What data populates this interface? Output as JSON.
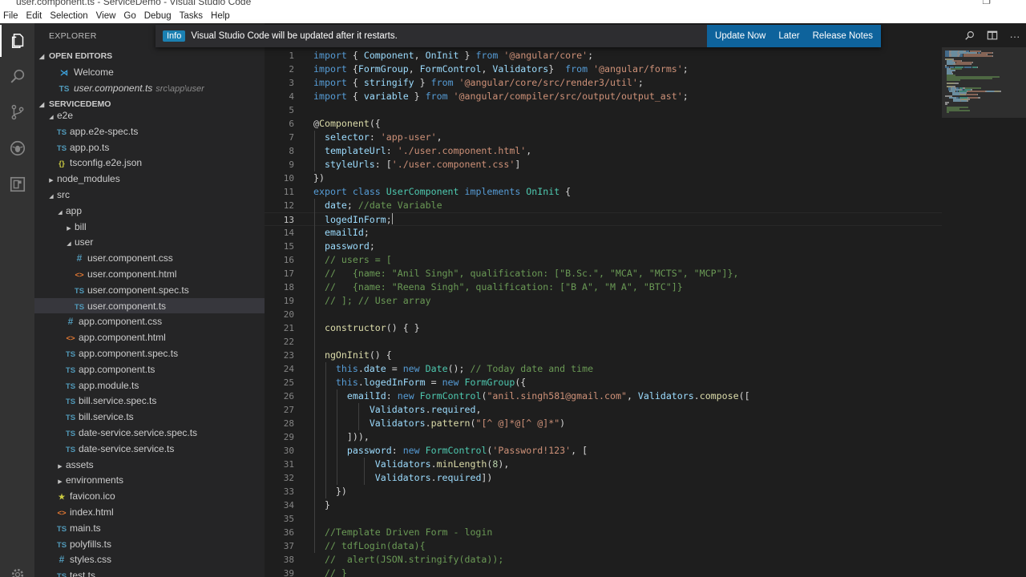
{
  "window": {
    "title": "user.component.ts - ServiceDemo - Visual Studio Code"
  },
  "menu": [
    "File",
    "Edit",
    "Selection",
    "View",
    "Go",
    "Debug",
    "Tasks",
    "Help"
  ],
  "activity_bar": [
    "files-icon",
    "search-icon",
    "source-control-icon",
    "debug-icon",
    "extensions-icon",
    "gear-icon"
  ],
  "sidebar": {
    "title": "EXPLORER",
    "open_editors": {
      "header": "OPEN EDITORS",
      "items": [
        {
          "icon": "vscode-icon",
          "name": "Welcome",
          "desc": ""
        },
        {
          "icon": "TS",
          "name": "user.component.ts",
          "desc": "src\\app\\user"
        }
      ]
    },
    "project": {
      "header": "SERVICEDEMO",
      "tree": [
        {
          "label": "e2e",
          "type": "folder",
          "open": true,
          "depth": 0
        },
        {
          "label": "app.e2e-spec.ts",
          "type": "ts",
          "depth": 1
        },
        {
          "label": "app.po.ts",
          "type": "ts",
          "depth": 1
        },
        {
          "label": "tsconfig.e2e.json",
          "type": "json",
          "depth": 1
        },
        {
          "label": "node_modules",
          "type": "folder",
          "open": false,
          "depth": 0
        },
        {
          "label": "src",
          "type": "folder",
          "open": true,
          "depth": 0
        },
        {
          "label": "app",
          "type": "folder",
          "open": true,
          "depth": 1
        },
        {
          "label": "bill",
          "type": "folder",
          "open": false,
          "depth": 2
        },
        {
          "label": "user",
          "type": "folder",
          "open": true,
          "depth": 2
        },
        {
          "label": "user.component.css",
          "type": "css",
          "depth": 3
        },
        {
          "label": "user.component.html",
          "type": "html",
          "depth": 3
        },
        {
          "label": "user.component.spec.ts",
          "type": "ts",
          "depth": 3
        },
        {
          "label": "user.component.ts",
          "type": "ts",
          "depth": 3,
          "selected": true
        },
        {
          "label": "app.component.css",
          "type": "css",
          "depth": 2
        },
        {
          "label": "app.component.html",
          "type": "html",
          "depth": 2
        },
        {
          "label": "app.component.spec.ts",
          "type": "ts",
          "depth": 2
        },
        {
          "label": "app.component.ts",
          "type": "ts",
          "depth": 2
        },
        {
          "label": "app.module.ts",
          "type": "ts",
          "depth": 2
        },
        {
          "label": "bill.service.spec.ts",
          "type": "ts",
          "depth": 2
        },
        {
          "label": "bill.service.ts",
          "type": "ts",
          "depth": 2
        },
        {
          "label": "date-service.service.spec.ts",
          "type": "ts",
          "depth": 2
        },
        {
          "label": "date-service.service.ts",
          "type": "ts",
          "depth": 2
        },
        {
          "label": "assets",
          "type": "folder",
          "open": false,
          "depth": 1
        },
        {
          "label": "environments",
          "type": "folder",
          "open": false,
          "depth": 1
        },
        {
          "label": "favicon.ico",
          "type": "star",
          "depth": 1
        },
        {
          "label": "index.html",
          "type": "html",
          "depth": 1
        },
        {
          "label": "main.ts",
          "type": "ts",
          "depth": 1
        },
        {
          "label": "polyfills.ts",
          "type": "ts",
          "depth": 1
        },
        {
          "label": "styles.css",
          "type": "css",
          "depth": 1
        },
        {
          "label": "test.ts",
          "type": "ts",
          "depth": 1
        }
      ]
    }
  },
  "notification": {
    "badge": "Info",
    "message": "Visual Studio Code will be updated after it restarts.",
    "actions": [
      "Update Now",
      "Later",
      "Release Notes"
    ]
  },
  "editor_actions": [
    "open-preview-icon",
    "split-editor-icon",
    "more-icon"
  ],
  "editor": {
    "cursor_line": 13,
    "lines": [
      [
        [
          "k",
          "import"
        ],
        [
          "p",
          " { "
        ],
        [
          "v",
          "Component"
        ],
        [
          "p",
          ", "
        ],
        [
          "v",
          "OnInit"
        ],
        [
          "p",
          " } "
        ],
        [
          "k",
          "from"
        ],
        [
          "p",
          " "
        ],
        [
          "s",
          "'@angular/core'"
        ],
        [
          "p",
          ";"
        ]
      ],
      [
        [
          "k",
          "import"
        ],
        [
          "p",
          " {"
        ],
        [
          "v",
          "FormGroup"
        ],
        [
          "p",
          ", "
        ],
        [
          "v",
          "FormControl"
        ],
        [
          "p",
          ", "
        ],
        [
          "v",
          "Validators"
        ],
        [
          "p",
          "}  "
        ],
        [
          "k",
          "from"
        ],
        [
          "p",
          " "
        ],
        [
          "s",
          "'@angular/forms'"
        ],
        [
          "p",
          ";"
        ]
      ],
      [
        [
          "k",
          "import"
        ],
        [
          "p",
          " { "
        ],
        [
          "v",
          "stringify"
        ],
        [
          "p",
          " } "
        ],
        [
          "k",
          "from"
        ],
        [
          "p",
          " "
        ],
        [
          "s",
          "'@angular/core/src/render3/util'"
        ],
        [
          "p",
          ";"
        ]
      ],
      [
        [
          "k",
          "import"
        ],
        [
          "p",
          " { "
        ],
        [
          "v",
          "variable"
        ],
        [
          "p",
          " } "
        ],
        [
          "k",
          "from"
        ],
        [
          "p",
          " "
        ],
        [
          "s",
          "'@angular/compiler/src/output/output_ast'"
        ],
        [
          "p",
          ";"
        ]
      ],
      [],
      [
        [
          "p",
          "@"
        ],
        [
          "f",
          "Component"
        ],
        [
          "p",
          "({"
        ]
      ],
      [
        [
          "p",
          "  "
        ],
        [
          "v",
          "selector"
        ],
        [
          "p",
          ": "
        ],
        [
          "s",
          "'app-user'"
        ],
        [
          "p",
          ","
        ]
      ],
      [
        [
          "p",
          "  "
        ],
        [
          "v",
          "templateUrl"
        ],
        [
          "p",
          ": "
        ],
        [
          "s",
          "'./user.component.html'"
        ],
        [
          "p",
          ","
        ]
      ],
      [
        [
          "p",
          "  "
        ],
        [
          "v",
          "styleUrls"
        ],
        [
          "p",
          ": ["
        ],
        [
          "s",
          "'./user.component.css'"
        ],
        [
          "p",
          "]"
        ]
      ],
      [
        [
          "p",
          "})"
        ]
      ],
      [
        [
          "k",
          "export"
        ],
        [
          "p",
          " "
        ],
        [
          "k",
          "class"
        ],
        [
          "p",
          " "
        ],
        [
          "t",
          "UserComponent"
        ],
        [
          "p",
          " "
        ],
        [
          "k",
          "implements"
        ],
        [
          "p",
          " "
        ],
        [
          "t",
          "OnInit"
        ],
        [
          "p",
          " {"
        ]
      ],
      [
        [
          "p",
          "  "
        ],
        [
          "v",
          "date"
        ],
        [
          "p",
          "; "
        ],
        [
          "c",
          "//date Variable"
        ]
      ],
      [
        [
          "p",
          "  "
        ],
        [
          "v",
          "logedInForm"
        ],
        [
          "p",
          ";"
        ]
      ],
      [
        [
          "p",
          "  "
        ],
        [
          "v",
          "emailId"
        ],
        [
          "p",
          ";"
        ]
      ],
      [
        [
          "p",
          "  "
        ],
        [
          "v",
          "password"
        ],
        [
          "p",
          ";"
        ]
      ],
      [
        [
          "p",
          "  "
        ],
        [
          "c",
          "// users = ["
        ]
      ],
      [
        [
          "p",
          "  "
        ],
        [
          "c",
          "//   {name: \"Anil Singh\", qualification: [\"B.Sc.\", \"MCA\", \"MCTS\", \"MCP\"]},"
        ]
      ],
      [
        [
          "p",
          "  "
        ],
        [
          "c",
          "//   {name: \"Reena Singh\", qualification: [\"B A\", \"M A\", \"BTC\"]}"
        ]
      ],
      [
        [
          "p",
          "  "
        ],
        [
          "c",
          "// ]; // User array"
        ]
      ],
      [],
      [
        [
          "p",
          "  "
        ],
        [
          "f",
          "constructor"
        ],
        [
          "p",
          "() { }"
        ]
      ],
      [],
      [
        [
          "p",
          "  "
        ],
        [
          "f",
          "ngOnInit"
        ],
        [
          "p",
          "() {"
        ]
      ],
      [
        [
          "p",
          "    "
        ],
        [
          "k",
          "this"
        ],
        [
          "p",
          "."
        ],
        [
          "v",
          "date"
        ],
        [
          "p",
          " = "
        ],
        [
          "k",
          "new"
        ],
        [
          "p",
          " "
        ],
        [
          "t",
          "Date"
        ],
        [
          "p",
          "(); "
        ],
        [
          "c",
          "// Today date and time"
        ]
      ],
      [
        [
          "p",
          "    "
        ],
        [
          "k",
          "this"
        ],
        [
          "p",
          "."
        ],
        [
          "v",
          "logedInForm"
        ],
        [
          "p",
          " = "
        ],
        [
          "k",
          "new"
        ],
        [
          "p",
          " "
        ],
        [
          "t",
          "FormGroup"
        ],
        [
          "p",
          "({"
        ]
      ],
      [
        [
          "p",
          "      "
        ],
        [
          "v",
          "emailId"
        ],
        [
          "p",
          ": "
        ],
        [
          "k",
          "new"
        ],
        [
          "p",
          " "
        ],
        [
          "t",
          "FormControl"
        ],
        [
          "p",
          "("
        ],
        [
          "s",
          "\"anil.singh581@gmail.com\""
        ],
        [
          "p",
          ", "
        ],
        [
          "v",
          "Validators"
        ],
        [
          "p",
          "."
        ],
        [
          "f",
          "compose"
        ],
        [
          "p",
          "(["
        ]
      ],
      [
        [
          "p",
          "          "
        ],
        [
          "v",
          "Validators"
        ],
        [
          "p",
          "."
        ],
        [
          "v",
          "required"
        ],
        [
          "p",
          ","
        ]
      ],
      [
        [
          "p",
          "          "
        ],
        [
          "v",
          "Validators"
        ],
        [
          "p",
          "."
        ],
        [
          "f",
          "pattern"
        ],
        [
          "p",
          "("
        ],
        [
          "s",
          "\"[^ @]*@[^ @]*\""
        ],
        [
          "p",
          ")"
        ]
      ],
      [
        [
          "p",
          "      ])),"
        ]
      ],
      [
        [
          "p",
          "      "
        ],
        [
          "v",
          "password"
        ],
        [
          "p",
          ": "
        ],
        [
          "k",
          "new"
        ],
        [
          "p",
          " "
        ],
        [
          "t",
          "FormControl"
        ],
        [
          "p",
          "("
        ],
        [
          "s",
          "'Password!123'"
        ],
        [
          "p",
          ", ["
        ]
      ],
      [
        [
          "p",
          "           "
        ],
        [
          "v",
          "Validators"
        ],
        [
          "p",
          "."
        ],
        [
          "f",
          "minLength"
        ],
        [
          "p",
          "("
        ],
        [
          "n",
          "8"
        ],
        [
          "p",
          "),"
        ]
      ],
      [
        [
          "p",
          "           "
        ],
        [
          "v",
          "Validators"
        ],
        [
          "p",
          "."
        ],
        [
          "v",
          "required"
        ],
        [
          "p",
          "])"
        ]
      ],
      [
        [
          "p",
          "    })"
        ]
      ],
      [
        [
          "p",
          "  }"
        ]
      ],
      [],
      [
        [
          "p",
          "  "
        ],
        [
          "c",
          "//Template Driven Form - login"
        ]
      ],
      [
        [
          "p",
          "  "
        ],
        [
          "c",
          "// tdfLogin(data){"
        ]
      ],
      [
        [
          "p",
          "  "
        ],
        [
          "c",
          "//  alert(JSON.stringify(data));"
        ]
      ],
      [
        [
          "p",
          "  "
        ],
        [
          "c",
          "// }"
        ]
      ]
    ]
  },
  "colors": {
    "accent": "#0e639c",
    "badge": "#1b80b2",
    "editor_bg": "#1e1e1e",
    "sidebar_bg": "#252526",
    "activity_bg": "#333333"
  }
}
